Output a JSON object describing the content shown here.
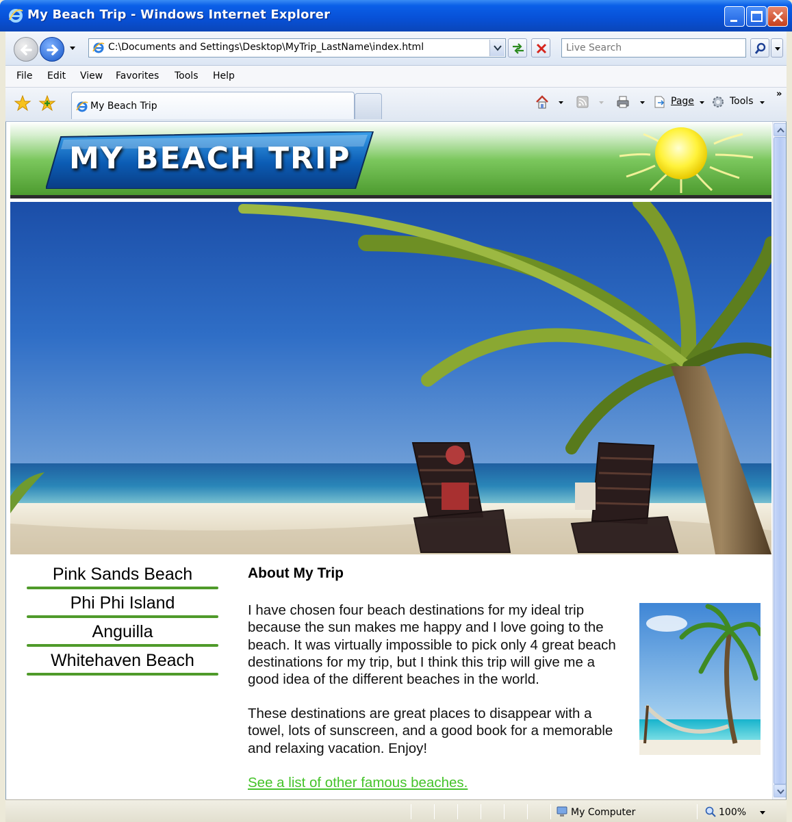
{
  "window": {
    "title": "My Beach Trip - Windows Internet Explorer"
  },
  "address_bar": {
    "url": "C:\\Documents and Settings\\Desktop\\MyTrip_LastName\\index.html"
  },
  "search": {
    "placeholder": "Live Search"
  },
  "menu": [
    "File",
    "Edit",
    "View",
    "Favorites",
    "Tools",
    "Help"
  ],
  "tabs": [
    {
      "label": "My Beach Trip",
      "active": true
    }
  ],
  "command_bar": {
    "page_label": "Page",
    "tools_label": "Tools"
  },
  "page": {
    "banner_title": "MY BEACH TRIP",
    "nav": [
      "Pink Sands Beach",
      "Phi Phi Island",
      "Anguilla",
      "Whitehaven Beach"
    ],
    "about_title": "About My Trip",
    "paragraph1": "I have chosen four beach destinations for my ideal trip because the sun makes me happy and I love going to the beach. It was virtually impossible to pick only 4 great beach destinations for my trip, but I think this trip will give me a good idea of the different beaches in the world.",
    "paragraph2": "These destinations are great places to disappear with a towel, lots of sunscreen, and a good book for a memorable and relaxing vacation. Enjoy!",
    "link_text": "See a list of other famous beaches."
  },
  "status_bar": {
    "zone": "My Computer",
    "zoom": "100%"
  },
  "colors": {
    "title_bar": "#0a5fe8",
    "banner_green": "#4d9b2f",
    "nav_rule": "#4f9a2a",
    "link": "#45c32a"
  }
}
